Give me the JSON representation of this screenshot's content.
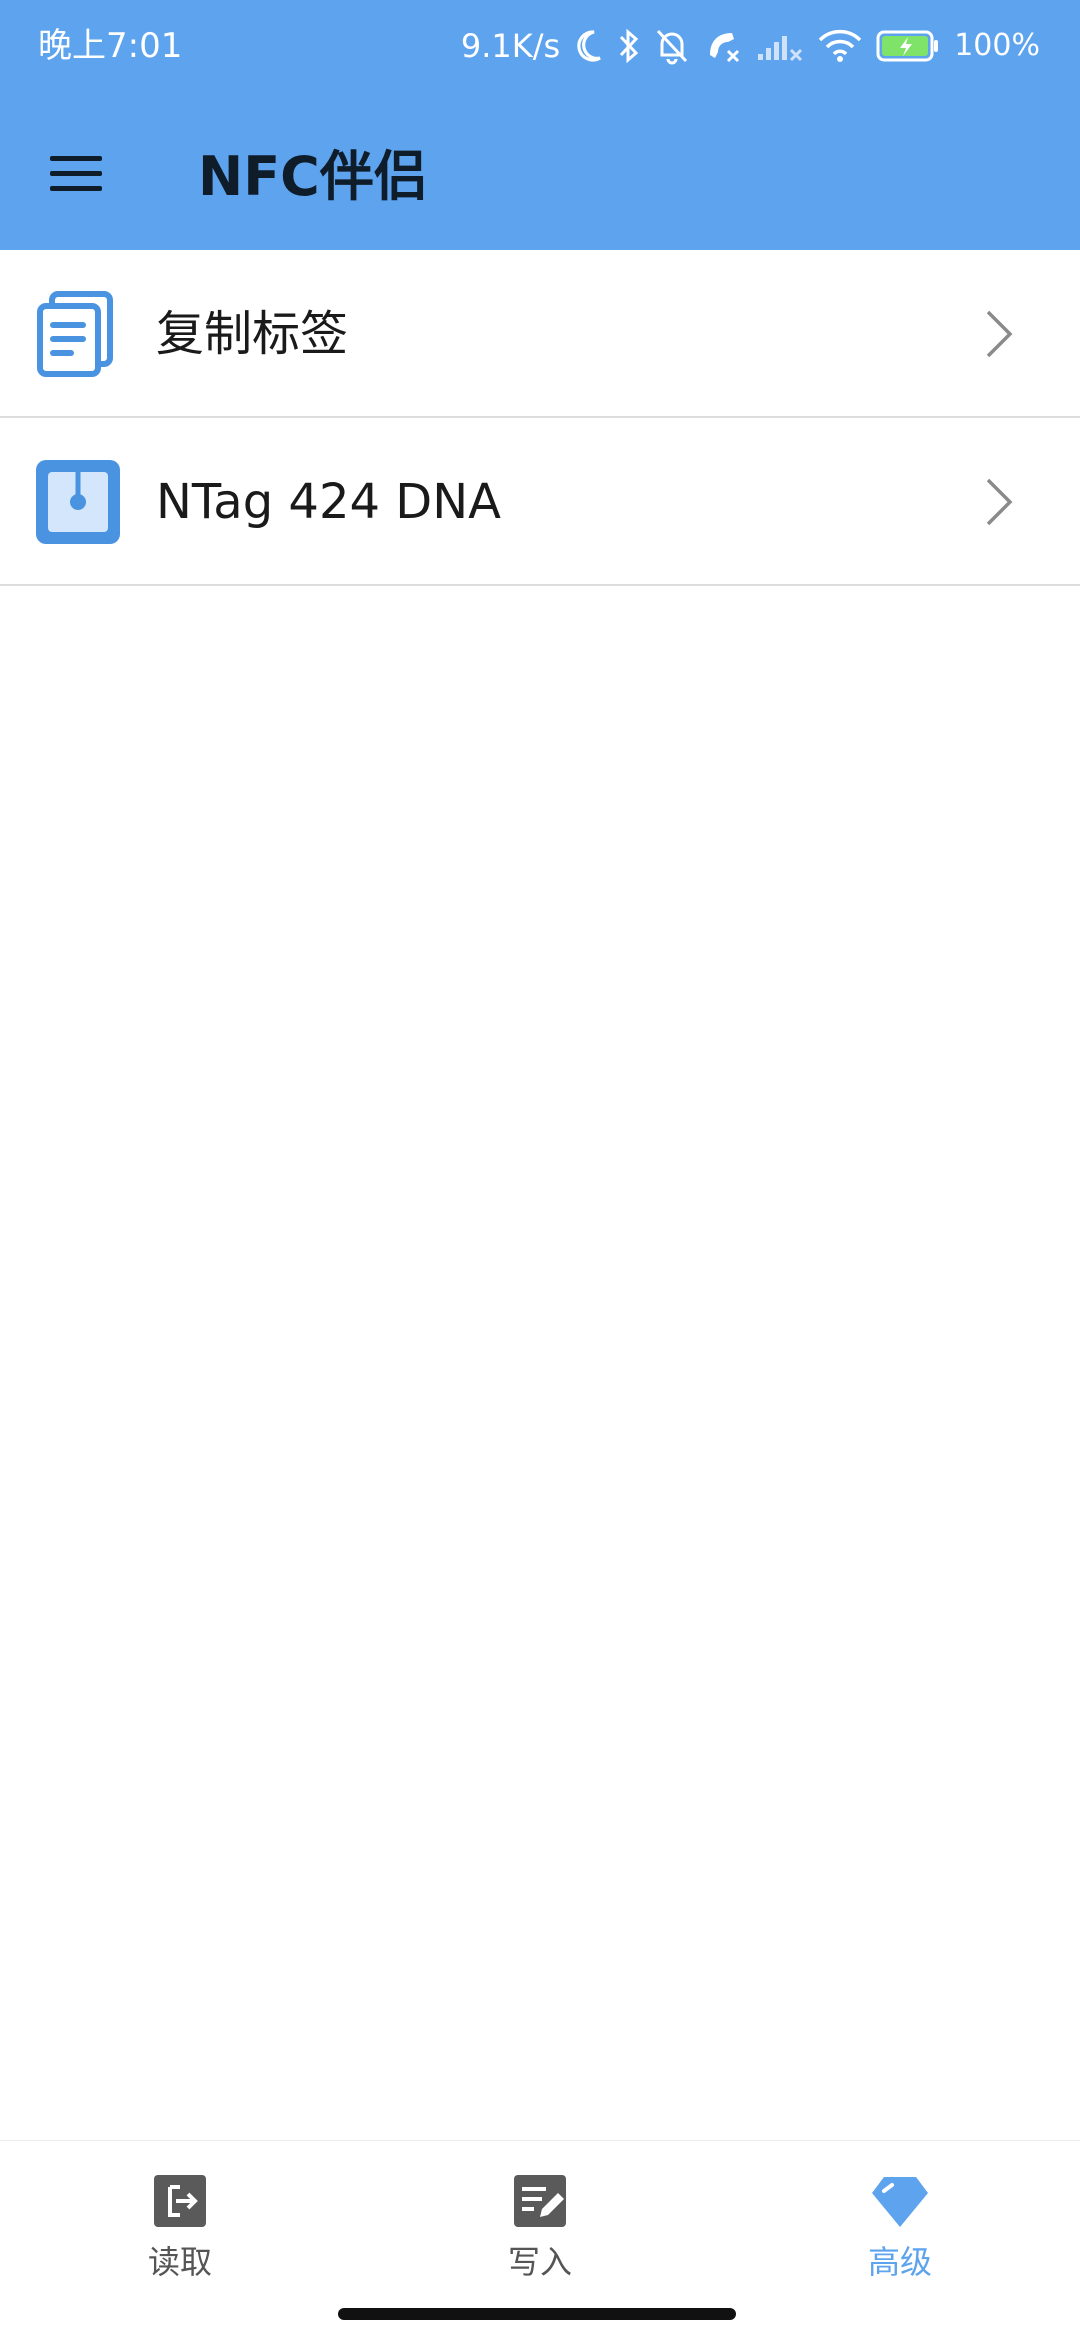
{
  "status_bar": {
    "time": "晚上7:01",
    "net_speed": "9.1K/s",
    "battery": "100%"
  },
  "app_bar": {
    "title": "NFC伴侣"
  },
  "list": {
    "items": [
      {
        "label": "复制标签",
        "icon": "copy-documents-icon"
      },
      {
        "label": "NTag 424 DNA",
        "icon": "nfc-tag-icon"
      }
    ]
  },
  "bottom_nav": {
    "items": [
      {
        "label": "读取",
        "icon": "read-export-icon",
        "active": false
      },
      {
        "label": "写入",
        "icon": "write-edit-icon",
        "active": false
      },
      {
        "label": "高级",
        "icon": "diamond-tag-icon",
        "active": true
      }
    ]
  },
  "colors": {
    "primary": "#5ea3ee",
    "title_text": "#0f1c2a",
    "nav_inactive": "#555555",
    "divider": "#dcdcdc"
  }
}
